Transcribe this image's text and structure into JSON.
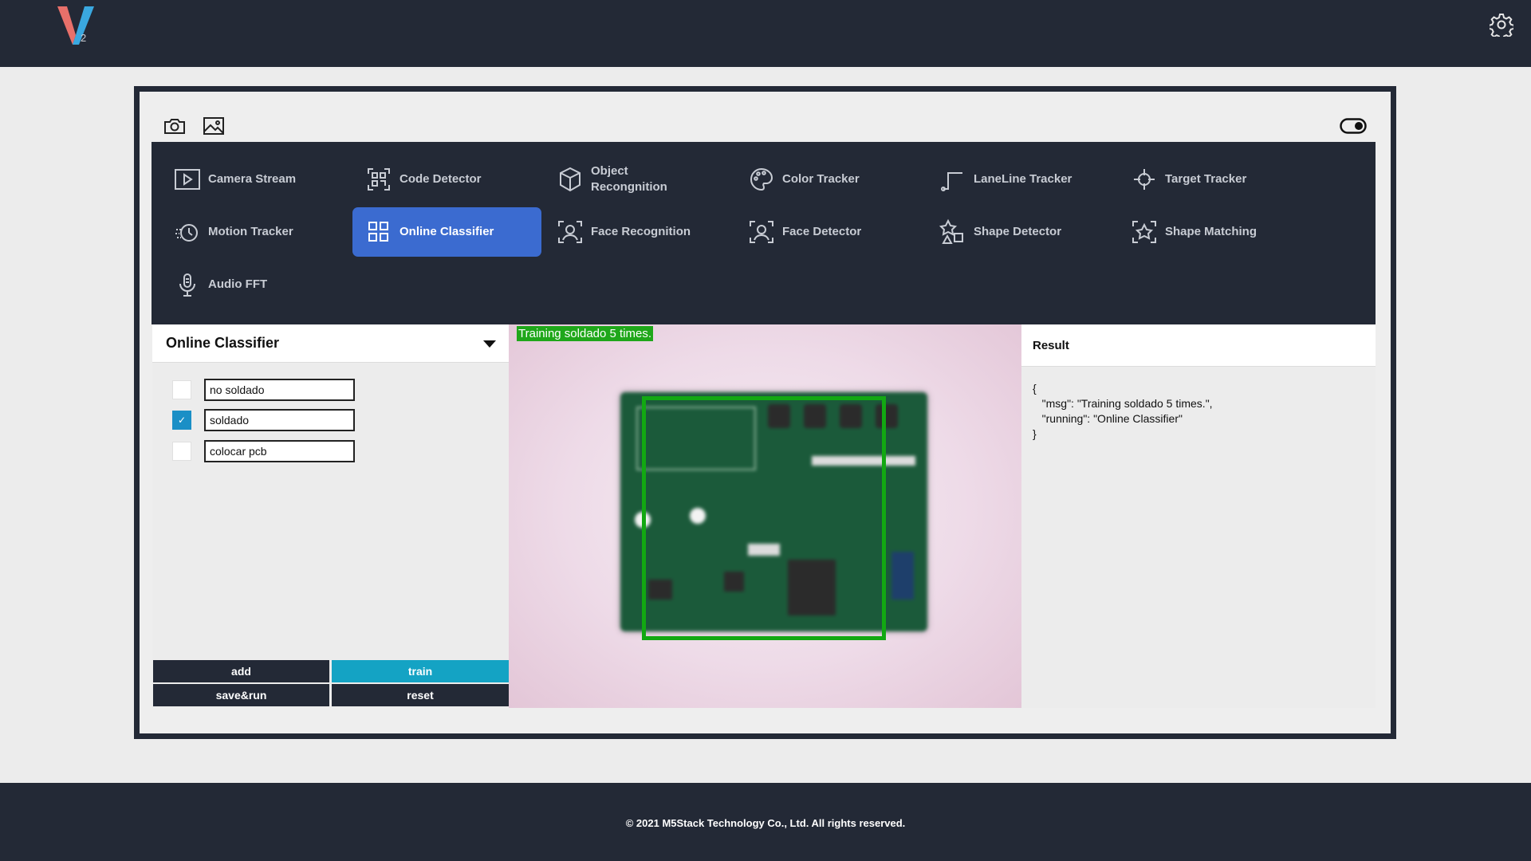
{
  "app": {
    "logo_sub": "2",
    "accent": "#3b6bd0"
  },
  "toolbar": {
    "icons": [
      "camera-icon",
      "image-icon",
      "toggle-icon"
    ]
  },
  "menu": {
    "items": [
      {
        "label": "Camera Stream",
        "icon": "play-icon"
      },
      {
        "label": "Code Detector",
        "icon": "qr-code-icon"
      },
      {
        "label": "Object Recongnition",
        "icon": "cube-icon"
      },
      {
        "label": "Color Tracker",
        "icon": "palette-icon"
      },
      {
        "label": "LaneLine Tracker",
        "icon": "lane-line-icon"
      },
      {
        "label": "Target Tracker",
        "icon": "crosshair-icon"
      },
      {
        "label": "Motion Tracker",
        "icon": "motion-icon"
      },
      {
        "label": "Online Classifier",
        "icon": "grid-icon",
        "active": true
      },
      {
        "label": "Face Recognition",
        "icon": "face-recognition-icon"
      },
      {
        "label": "Face Detector",
        "icon": "face-detector-icon"
      },
      {
        "label": "Shape Detector",
        "icon": "shapes-icon"
      },
      {
        "label": "Shape Matching",
        "icon": "star-matching-icon"
      },
      {
        "label": "Audio FFT",
        "icon": "microphone-icon"
      }
    ]
  },
  "classifier": {
    "title": "Online Classifier",
    "classes": [
      {
        "name": "no soldado",
        "checked": false
      },
      {
        "name": "soldado",
        "checked": true
      },
      {
        "name": "colocar pcb",
        "checked": false
      }
    ],
    "buttons": {
      "add": "add",
      "train": "train",
      "save_run": "save&run",
      "reset": "reset"
    }
  },
  "camera": {
    "overlay_text": "Training soldado 5 times."
  },
  "result": {
    "title": "Result",
    "body": "{\n   \"msg\": \"Training soldado 5 times.\",\n   \"running\": \"Online Classifier\"\n}"
  },
  "footer": {
    "copyright": "© 2021 M5Stack Technology Co., Ltd. All rights reserved."
  }
}
